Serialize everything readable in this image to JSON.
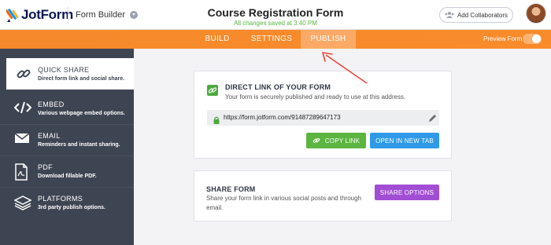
{
  "header": {
    "logo_text": "JotForm",
    "builder_label": "Form Builder",
    "form_title": "Course Registration Form",
    "save_status": "All changes saved at 3:40 PM",
    "collaborators_label": "Add Collaborators"
  },
  "nav": {
    "tabs": [
      {
        "label": "BUILD",
        "active": false
      },
      {
        "label": "SETTINGS",
        "active": false
      },
      {
        "label": "PUBLISH",
        "active": true
      }
    ],
    "preview_label": "Preview Form"
  },
  "sidebar": {
    "items": [
      {
        "title": "QUICK SHARE",
        "desc": "Direct form link and social share.",
        "icon": "link-icon",
        "active": true
      },
      {
        "title": "EMBED",
        "desc": "Various webpage embed options.",
        "icon": "code-icon",
        "active": false
      },
      {
        "title": "EMAIL",
        "desc": "Reminders and instant sharing.",
        "icon": "envelope-icon",
        "active": false
      },
      {
        "title": "PDF",
        "desc": "Download fillable PDF.",
        "icon": "pdf-icon",
        "active": false
      },
      {
        "title": "PLATFORMS",
        "desc": "3rd party publish options.",
        "icon": "layers-icon",
        "active": false
      }
    ]
  },
  "direct_link": {
    "title": "DIRECT LINK OF YOUR FORM",
    "desc": "Your form is securely published and ready to use at this address.",
    "url": "https://form.jotform.com/91487289647173",
    "copy_label": "COPY LINK",
    "open_label": "OPEN IN NEW TAB"
  },
  "share_form": {
    "title": "SHARE FORM",
    "desc": "Share your form link in various social posts and through email.",
    "button_label": "SHARE OPTIONS"
  },
  "colors": {
    "accent_orange": "#f98b2b",
    "sidebar_bg": "#3e4552",
    "copy_green": "#5cb540",
    "open_blue": "#2f9be8",
    "share_purple": "#a24ed4",
    "status_green": "#58b540",
    "annotation_red": "#e8473c"
  }
}
